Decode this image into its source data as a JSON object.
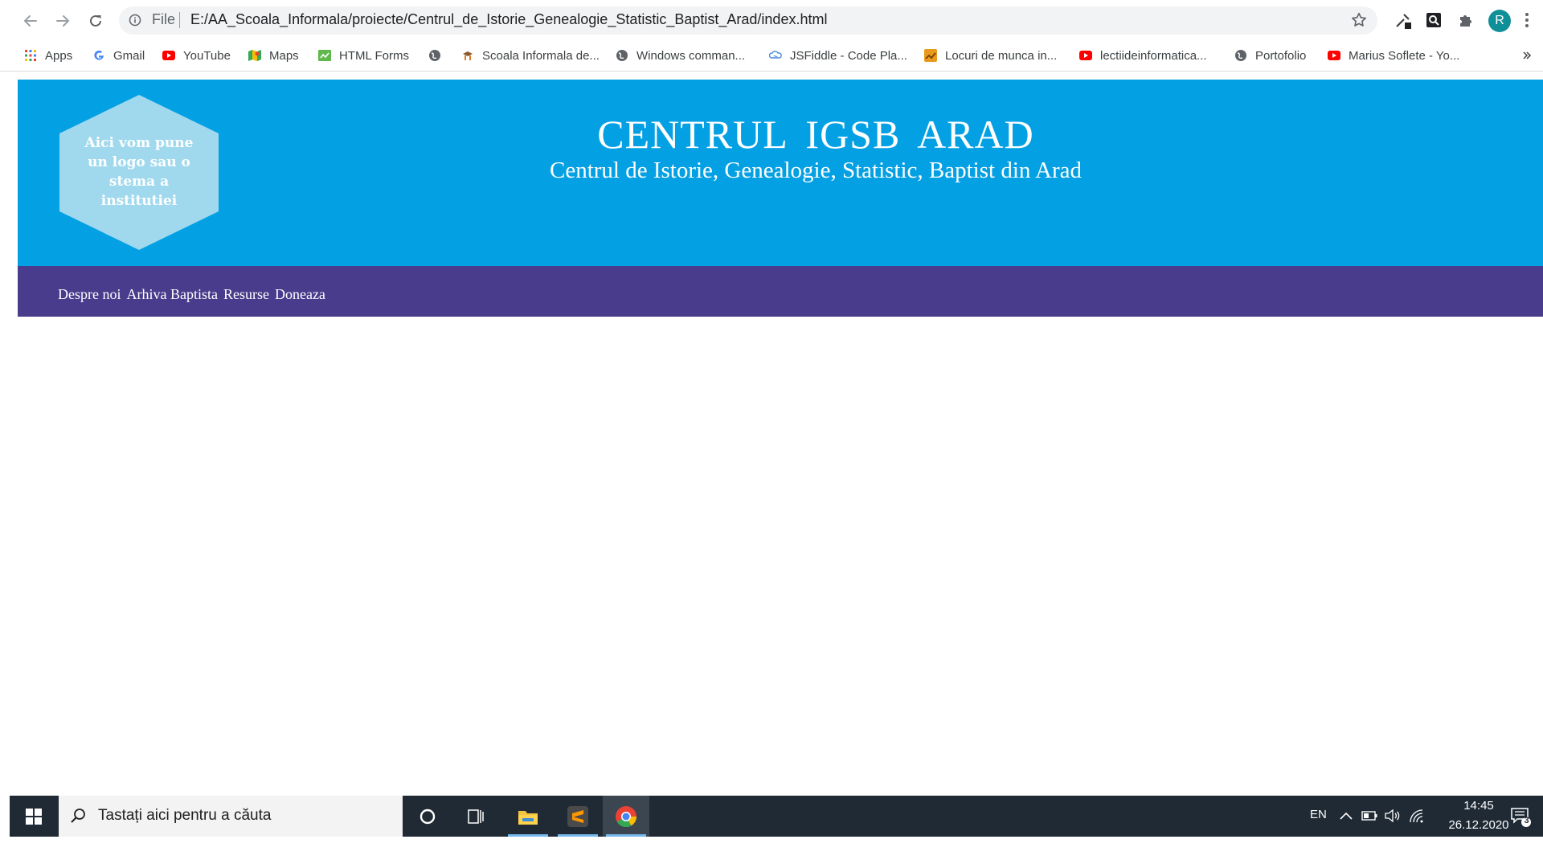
{
  "browser": {
    "omnibox": {
      "scheme_label": "File",
      "url": "E:/AA_Scoala_Informala/proiecte/Centrul_de_Istorie_Genealogie_Statistic_Baptist_Arad/index.html"
    },
    "profile_initial": "R",
    "bookmarks": [
      {
        "label": "Apps",
        "icon": "apps-grid-icon"
      },
      {
        "label": "Gmail",
        "icon": "google-icon"
      },
      {
        "label": "YouTube",
        "icon": "youtube-icon"
      },
      {
        "label": "Maps",
        "icon": "maps-icon"
      },
      {
        "label": "HTML Forms",
        "icon": "html-forms-icon"
      },
      {
        "label": "",
        "icon": "globe-icon"
      },
      {
        "label": "Scoala Informala de...",
        "icon": "scoala-informala-icon"
      },
      {
        "label": "Windows comman...",
        "icon": "globe-icon"
      },
      {
        "label": "JSFiddle - Code Pla...",
        "icon": "jsfiddle-icon"
      },
      {
        "label": "Locuri de munca in...",
        "icon": "chart-icon"
      },
      {
        "label": "lectiideinformatica...",
        "icon": "youtube-icon"
      },
      {
        "label": "Portofolio",
        "icon": "globe-icon"
      },
      {
        "label": "Marius Soflete - Yo...",
        "icon": "youtube-icon"
      }
    ]
  },
  "site": {
    "logo_text": "Aici vom pune un logo sau o stema a institutiei",
    "title": "CENTRUL IGSB ARAD",
    "subtitle": "Centrul de Istorie, Genealogie, Statistic, Baptist din Arad",
    "nav": [
      "Despre noi",
      "Arhiva Baptista",
      "Resurse",
      "Doneaza"
    ]
  },
  "taskbar": {
    "search_placeholder": "Tastați aici pentru a căuta",
    "language": "EN",
    "time": "14:45",
    "date": "26.12.2020",
    "notification_count": "3"
  },
  "colors": {
    "header_bg": "#04a0e4",
    "nav_bg": "#4a3c8c",
    "logo_hex": "#a0d9ee",
    "taskbar_bg": "#1f2a35"
  }
}
